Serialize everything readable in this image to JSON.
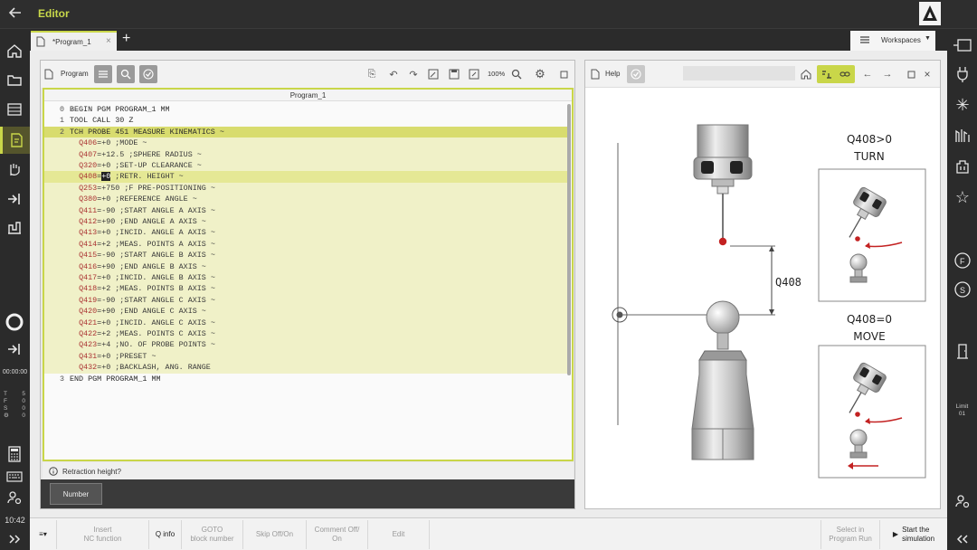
{
  "titlebar": {
    "title": "Editor"
  },
  "tabs": {
    "program_tab": "*Program_1",
    "workspaces": "Workspaces"
  },
  "program": {
    "title": "Program",
    "zoom": "100%",
    "header": "Program_1",
    "lines": [
      {
        "num": "0",
        "text": "BEGIN PGM PROGRAM_1 MM"
      },
      {
        "num": "1",
        "text": "TOOL CALL 30 Z"
      },
      {
        "num": "2",
        "text": "TCH PROBE 451 MEASURE KINEMATICS ~"
      },
      {
        "num": "",
        "q": "Q406",
        "rest": "=+0 ;MODE ~"
      },
      {
        "num": "",
        "q": "Q407",
        "rest": "=+12.5 ;SPHERE RADIUS ~"
      },
      {
        "num": "",
        "q": "Q320",
        "rest": "=+0 ;SET-UP CLEARANCE ~"
      },
      {
        "num": "",
        "q": "Q408",
        "rest": "=+0 ;RETR. HEIGHT ~"
      },
      {
        "num": "",
        "q": "Q253",
        "rest": "=+750 ;F PRE-POSITIONING ~"
      },
      {
        "num": "",
        "q": "Q380",
        "rest": "=+0 ;REFERENCE ANGLE ~"
      },
      {
        "num": "",
        "q": "Q411",
        "rest": "=-90 ;START ANGLE A AXIS ~"
      },
      {
        "num": "",
        "q": "Q412",
        "rest": "=+90 ;END ANGLE A AXIS ~"
      },
      {
        "num": "",
        "q": "Q413",
        "rest": "=+0 ;INCID. ANGLE A AXIS ~"
      },
      {
        "num": "",
        "q": "Q414",
        "rest": "=+2 ;MEAS. POINTS A AXIS ~"
      },
      {
        "num": "",
        "q": "Q415",
        "rest": "=-90 ;START ANGLE B AXIS ~"
      },
      {
        "num": "",
        "q": "Q416",
        "rest": "=+90 ;END ANGLE B AXIS ~"
      },
      {
        "num": "",
        "q": "Q417",
        "rest": "=+0 ;INCID. ANGLE B AXIS ~"
      },
      {
        "num": "",
        "q": "Q418",
        "rest": "=+2 ;MEAS. POINTS B AXIS ~"
      },
      {
        "num": "",
        "q": "Q419",
        "rest": "=-90 ;START ANGLE C AXIS ~"
      },
      {
        "num": "",
        "q": "Q420",
        "rest": "=+90 ;END ANGLE C AXIS ~"
      },
      {
        "num": "",
        "q": "Q421",
        "rest": "=+0 ;INCID. ANGLE C AXIS ~"
      },
      {
        "num": "",
        "q": "Q422",
        "rest": "=+2 ;MEAS. POINTS C AXIS ~"
      },
      {
        "num": "",
        "q": "Q423",
        "rest": "=+4 ;NO. OF PROBE POINTS ~"
      },
      {
        "num": "",
        "q": "Q431",
        "rest": "=+0 ;PRESET ~"
      },
      {
        "num": "",
        "q": "Q432",
        "rest": "=+0 ;BACKLASH, ANG. RANGE"
      },
      {
        "num": "3",
        "text": "END PGM PROGRAM_1 MM"
      }
    ],
    "status": "Retraction height?",
    "number_button": "Number"
  },
  "help": {
    "title": "Help",
    "dimension_label": "Q408",
    "turn_condition": "Q408>0",
    "turn_label": "TURN",
    "move_condition": "Q408=0",
    "move_label": "MOVE"
  },
  "left_sidebar": {
    "clock_top": "00:00:00",
    "readout_labels": [
      "T",
      "F",
      "S"
    ],
    "readout_values": [
      "5",
      "0",
      "0",
      "0"
    ],
    "time": "10:42"
  },
  "right_sidebar": {
    "limit_label": "Limit",
    "limit_value": "01"
  },
  "softkeys": {
    "insert": "Insert\nNC function",
    "qinfo": "Q info",
    "goto": "GOTO\nblock number",
    "skip": "Skip Off/On",
    "comment": "Comment Off/\nOn",
    "edit": "Edit",
    "select": "Select in\nProgram Run",
    "start": "Start the\nsimulation"
  },
  "colors": {
    "accent": "#c9d649",
    "q_param": "#aa3333",
    "highlight_block": "#f0f1c8",
    "highlight_line": "#d8dc6e"
  }
}
